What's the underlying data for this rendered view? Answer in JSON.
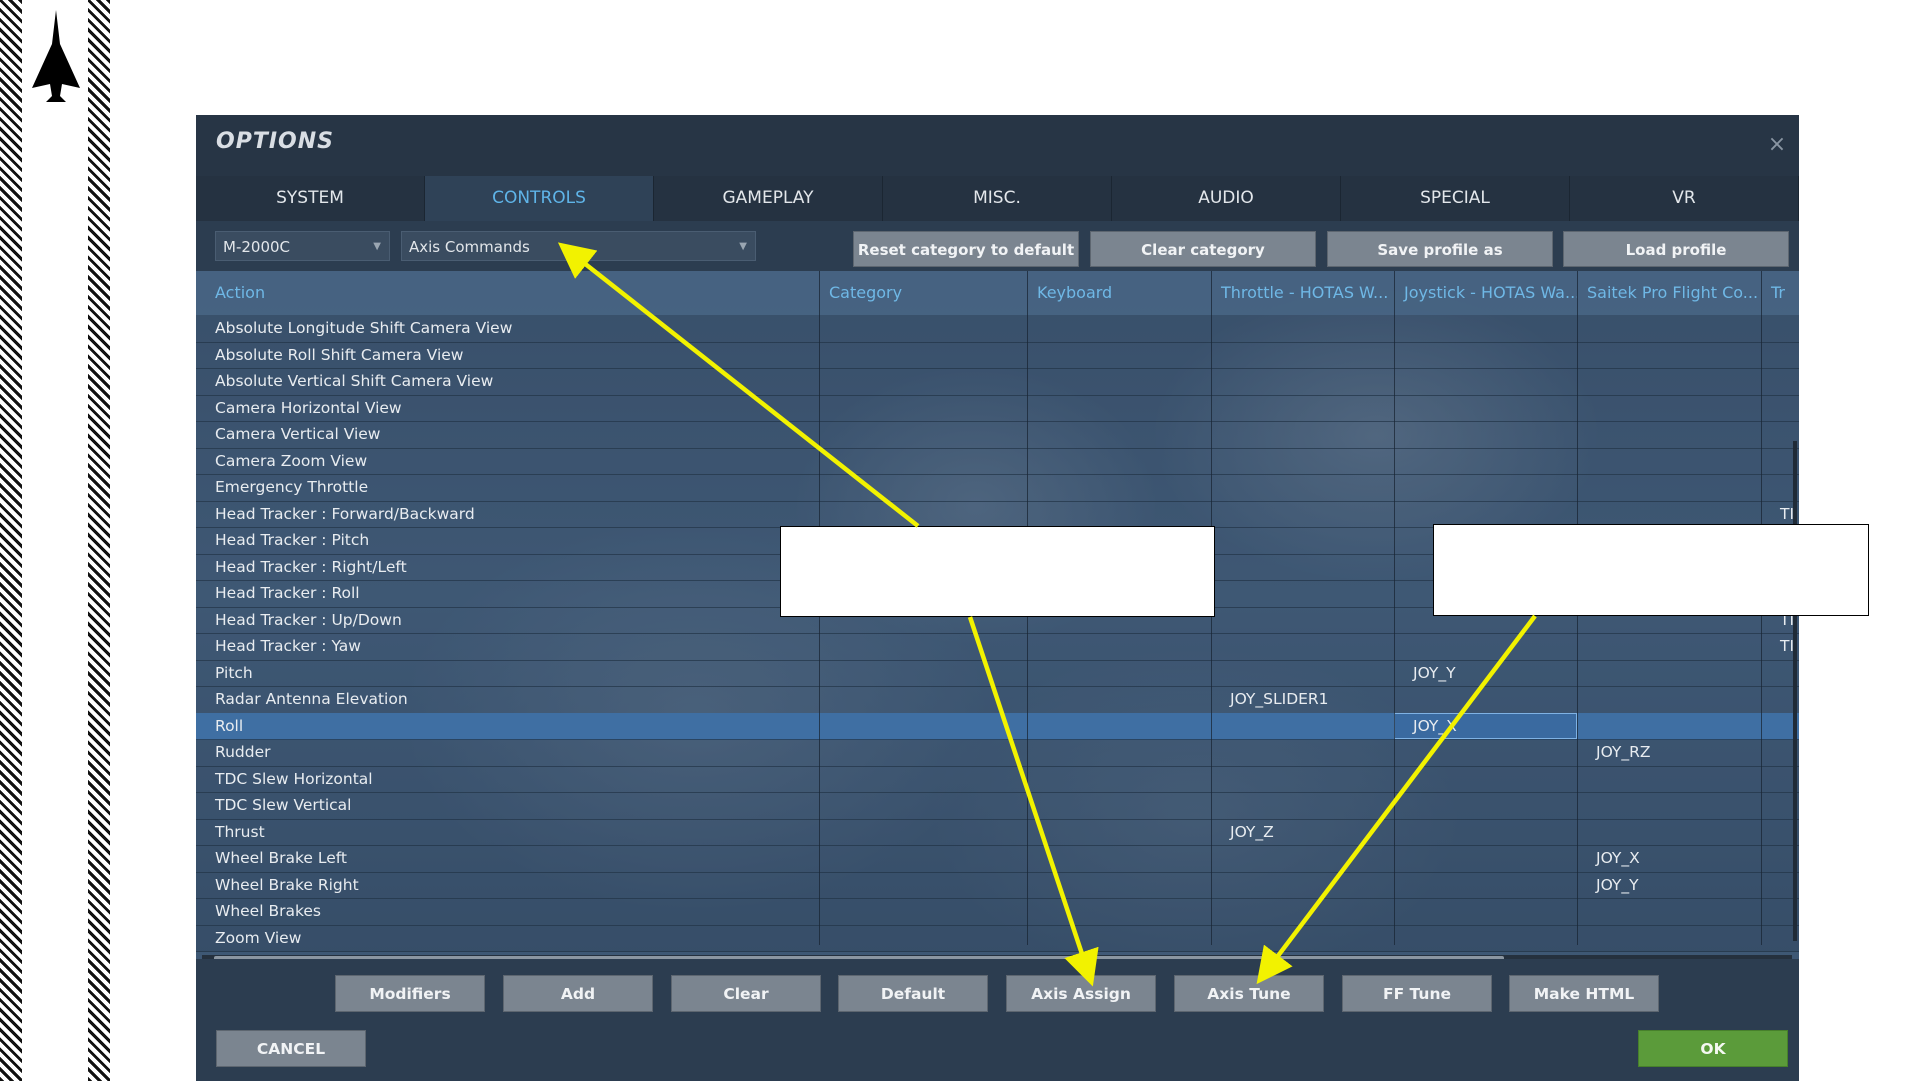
{
  "window": {
    "title": "OPTIONS",
    "close_glyph": "×"
  },
  "tabs": [
    {
      "label": "SYSTEM"
    },
    {
      "label": "CONTROLS",
      "active": true
    },
    {
      "label": "GAMEPLAY"
    },
    {
      "label": "MISC."
    },
    {
      "label": "AUDIO"
    },
    {
      "label": "SPECIAL"
    },
    {
      "label": "VR"
    }
  ],
  "toolbar": {
    "aircraft_select": "M-2000C",
    "category_select": "Axis Commands",
    "reset_label": "Reset category to default",
    "clear_label": "Clear category",
    "save_label": "Save profile as",
    "load_label": "Load profile"
  },
  "columns": [
    "Action",
    "Category",
    "Keyboard",
    "Throttle - HOTAS W...",
    "Joystick - HOTAS Wa...",
    "Saitek Pro Flight Co...",
    "Tr"
  ],
  "rows": [
    {
      "action": "Absolute Longitude Shift Camera View",
      "throttle": "",
      "joystick": "",
      "saitek": ""
    },
    {
      "action": "Absolute Roll Shift Camera View",
      "throttle": "",
      "joystick": "",
      "saitek": ""
    },
    {
      "action": "Absolute Vertical Shift Camera View",
      "throttle": "",
      "joystick": "",
      "saitek": ""
    },
    {
      "action": "Camera Horizontal View",
      "throttle": "",
      "joystick": "",
      "saitek": ""
    },
    {
      "action": "Camera Vertical View",
      "throttle": "",
      "joystick": "",
      "saitek": ""
    },
    {
      "action": "Camera Zoom View",
      "throttle": "",
      "joystick": "",
      "saitek": ""
    },
    {
      "action": "Emergency Throttle",
      "throttle": "",
      "joystick": "",
      "saitek": ""
    },
    {
      "action": "Head Tracker : Forward/Backward",
      "throttle": "",
      "joystick": "",
      "saitek": "",
      "tr": "TI"
    },
    {
      "action": "Head Tracker : Pitch",
      "throttle": "",
      "joystick": "",
      "saitek": ""
    },
    {
      "action": "Head Tracker : Right/Left",
      "throttle": "",
      "joystick": "",
      "saitek": ""
    },
    {
      "action": "Head Tracker : Roll",
      "throttle": "",
      "joystick": "",
      "saitek": ""
    },
    {
      "action": "Head Tracker : Up/Down",
      "throttle": "",
      "joystick": "",
      "saitek": "",
      "tr": "TI"
    },
    {
      "action": "Head Tracker : Yaw",
      "throttle": "",
      "joystick": "",
      "saitek": "",
      "tr": "TI"
    },
    {
      "action": "Pitch",
      "throttle": "",
      "joystick": "JOY_Y",
      "saitek": ""
    },
    {
      "action": "Radar Antenna Elevation",
      "throttle": "JOY_SLIDER1",
      "joystick": "",
      "saitek": ""
    },
    {
      "action": "Roll",
      "throttle": "",
      "joystick": "JOY_X",
      "saitek": "",
      "selected": true
    },
    {
      "action": "Rudder",
      "throttle": "",
      "joystick": "",
      "saitek": "JOY_RZ"
    },
    {
      "action": "TDC Slew Horizontal",
      "throttle": "",
      "joystick": "",
      "saitek": ""
    },
    {
      "action": "TDC Slew Vertical",
      "throttle": "",
      "joystick": "",
      "saitek": ""
    },
    {
      "action": "Thrust",
      "throttle": "JOY_Z",
      "joystick": "",
      "saitek": ""
    },
    {
      "action": "Wheel Brake Left",
      "throttle": "",
      "joystick": "",
      "saitek": "JOY_X"
    },
    {
      "action": "Wheel Brake Right",
      "throttle": "",
      "joystick": "",
      "saitek": "JOY_Y"
    },
    {
      "action": "Wheel Brakes",
      "throttle": "",
      "joystick": "",
      "saitek": ""
    },
    {
      "action": "Zoom View",
      "throttle": "",
      "joystick": "",
      "saitek": ""
    }
  ],
  "bottom_buttons": [
    "Modifiers",
    "Add",
    "Clear",
    "Default",
    "Axis Assign",
    "Axis Tune",
    "FF Tune",
    "Make HTML"
  ],
  "footer": {
    "cancel_label": "CANCEL",
    "ok_label": "OK"
  },
  "colors": {
    "arrow": "#f2f200",
    "ok": "#5b9b3a",
    "active_tab": "#5fb4e8",
    "selected_row": "#3f6fa3"
  },
  "icons": {
    "aircraft": "jet-silhouette-icon",
    "close": "close-icon"
  }
}
